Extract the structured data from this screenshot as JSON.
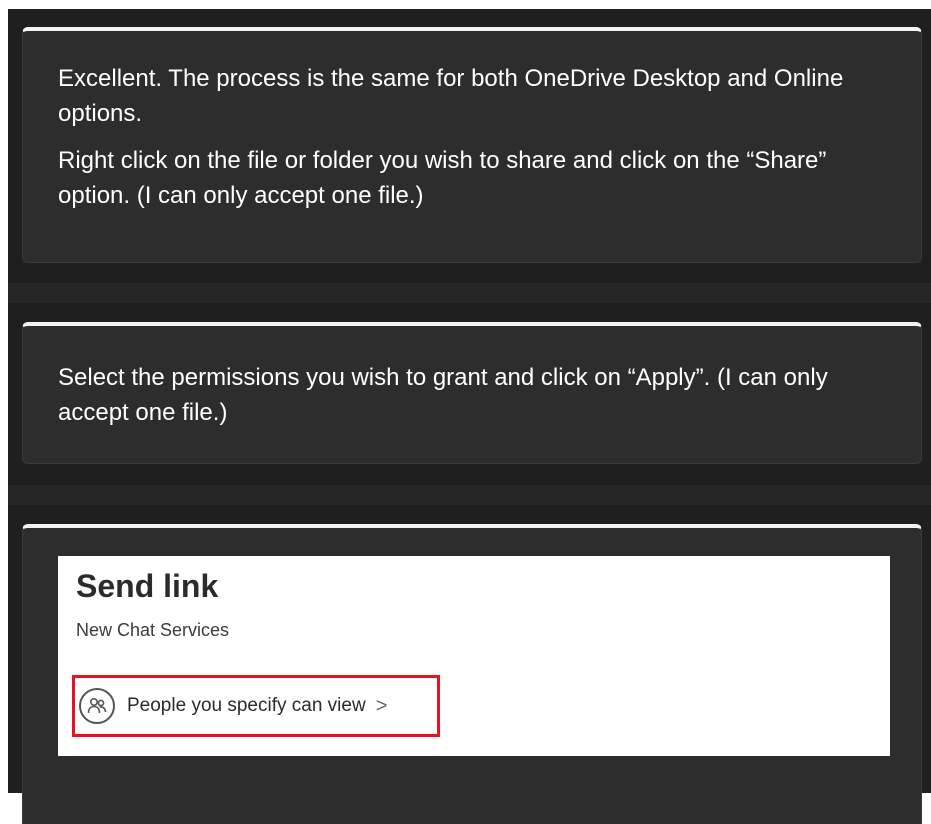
{
  "messages": [
    {
      "paragraphs": [
        "Excellent. The process is the same for both OneDrive Desktop and Online options.",
        "Right click on the file or folder you wish to share and click on the “Share” option. (I can only accept one file.)"
      ]
    },
    {
      "paragraphs": [
        "Select the permissions you wish to grant and click on “Apply”. (I can only accept one file.)"
      ]
    }
  ],
  "send_link": {
    "title": "Send link",
    "subtitle": "New Chat Services",
    "permission_label": "People you specify can view",
    "chevron": ">"
  },
  "colors": {
    "chat_background": "#1f1f1f",
    "card_background": "#2d2d2d",
    "card_top_border": "#f3f3f3",
    "highlight_border": "#e81123"
  },
  "icons": {
    "permission": "people-icon",
    "chevron": "chevron-right-icon"
  }
}
